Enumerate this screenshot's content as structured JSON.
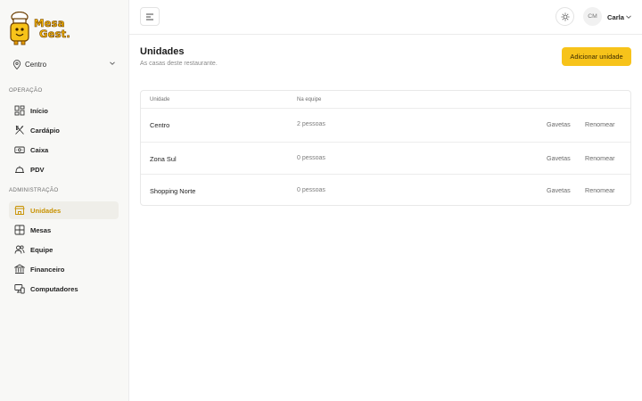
{
  "brand": {
    "line1": "Mesa",
    "line2": "Gest.",
    "accent": "#f7c31a"
  },
  "branch_selector": {
    "value": "Centro",
    "icon": "map-pin-icon"
  },
  "sidebar": {
    "sections": [
      {
        "title": "OPERAÇÃO",
        "items": [
          {
            "label": "Início",
            "icon": "dashboard-icon"
          },
          {
            "label": "Cardápio",
            "icon": "utensils-icon"
          },
          {
            "label": "Caixa",
            "icon": "cash-icon"
          },
          {
            "label": "PDV",
            "icon": "cloche-icon"
          }
        ]
      },
      {
        "title": "ADMINISTRAÇÃO",
        "items": [
          {
            "label": "Unidades",
            "icon": "store-icon",
            "active": true
          },
          {
            "label": "Mesas",
            "icon": "table-grid-icon"
          },
          {
            "label": "Equipe",
            "icon": "users-icon"
          },
          {
            "label": "Financeiro",
            "icon": "bank-icon"
          },
          {
            "label": "Computadores",
            "icon": "devices-icon"
          }
        ]
      }
    ]
  },
  "header": {
    "menu_icon": "menu-icon",
    "theme_icon": "sun-icon",
    "avatar_initials": "CM",
    "user_name": "Carla"
  },
  "page": {
    "title": "Unidades",
    "subtitle": "As casas deste restaurante.",
    "add_button": "Adicionar unidade"
  },
  "table": {
    "columns": [
      "Unidade",
      "Na equipe"
    ],
    "rows": [
      {
        "name": "Centro",
        "team": "2 pessoas",
        "action1": "Gavetas",
        "action2": "Renomear"
      },
      {
        "name": "Zona Sul",
        "team": "0 pessoas",
        "action1": "Gavetas",
        "action2": "Renomear"
      },
      {
        "name": "Shopping Norte",
        "team": "0 pessoas",
        "action1": "Gavetas",
        "action2": "Renomear"
      }
    ]
  }
}
